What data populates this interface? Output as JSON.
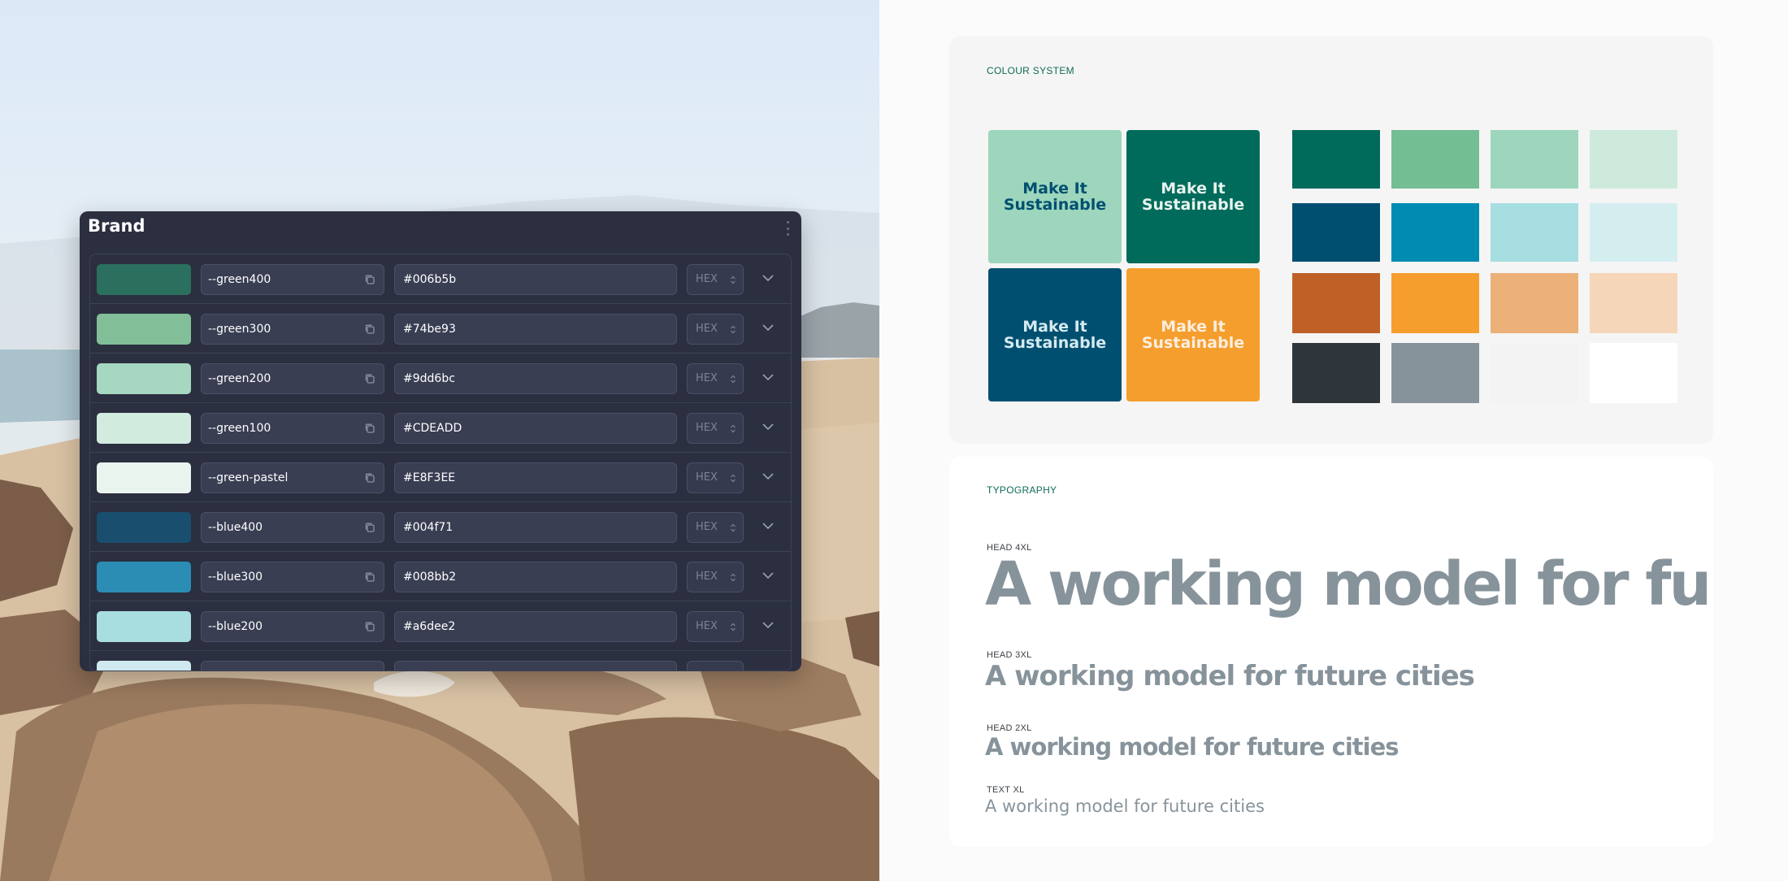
{
  "brand_panel": {
    "title": "Brand",
    "rows": [
      {
        "variable": "--green400",
        "value": "#006b5b",
        "format": "HEX",
        "swatch": "#2b6f5e"
      },
      {
        "variable": "--green300",
        "value": "#74be93",
        "format": "HEX",
        "swatch": "#82bf98"
      },
      {
        "variable": "--green200",
        "value": "#9dd6bc",
        "format": "HEX",
        "swatch": "#a6d7c0"
      },
      {
        "variable": "--green100",
        "value": "#CDEADD",
        "format": "HEX",
        "swatch": "#d2ebdf"
      },
      {
        "variable": "--green-pastel",
        "value": "#E8F3EE",
        "format": "HEX",
        "swatch": "#eaf4ef"
      },
      {
        "variable": "--blue400",
        "value": "#004f71",
        "format": "HEX",
        "swatch": "#1a4e6e"
      },
      {
        "variable": "--blue300",
        "value": "#008bb2",
        "format": "HEX",
        "swatch": "#2b8db4"
      },
      {
        "variable": "--blue200",
        "value": "#a6dee2",
        "format": "HEX",
        "swatch": "#a9dee1"
      },
      {
        "variable": "",
        "value": "",
        "format": "",
        "swatch": "#cfe9ee"
      }
    ]
  },
  "colour_system": {
    "label": "COLOUR SYSTEM",
    "tiles": [
      {
        "text": "Make It Sustainable",
        "bg": "#9dd6bc",
        "fg": "#004f71"
      },
      {
        "text": "Make It Sustainable",
        "bg": "#006b5b",
        "fg": "#e8f3ee"
      },
      {
        "text": "Make It Sustainable",
        "bg": "#004f71",
        "fg": "#d5eaf0"
      },
      {
        "text": "Make It Sustainable",
        "bg": "#f59e2d",
        "fg": "#fbeede"
      }
    ],
    "palette": [
      [
        "#006b5b",
        "#74be93",
        "#9dd6bc",
        "#cdeadd"
      ],
      [
        "#004f71",
        "#008bb2",
        "#a6dee2",
        "#d4eef0"
      ],
      [
        "#bf6126",
        "#f59e2d",
        "#ecb179",
        "#f6d6b9"
      ],
      [
        "#2e353b",
        "#87939b",
        "#f3f3f3",
        "#ffffff"
      ]
    ]
  },
  "typography": {
    "label": "TYPOGRAPHY",
    "styles": [
      {
        "name": "HEAD 4XL",
        "sample": "A working model for future cities"
      },
      {
        "name": "HEAD 3XL",
        "sample": "A working model for future cities"
      },
      {
        "name": "HEAD 2XL",
        "sample": "A working model for future cities"
      },
      {
        "name": "TEXT XL",
        "sample": "A working model for future cities"
      }
    ]
  }
}
